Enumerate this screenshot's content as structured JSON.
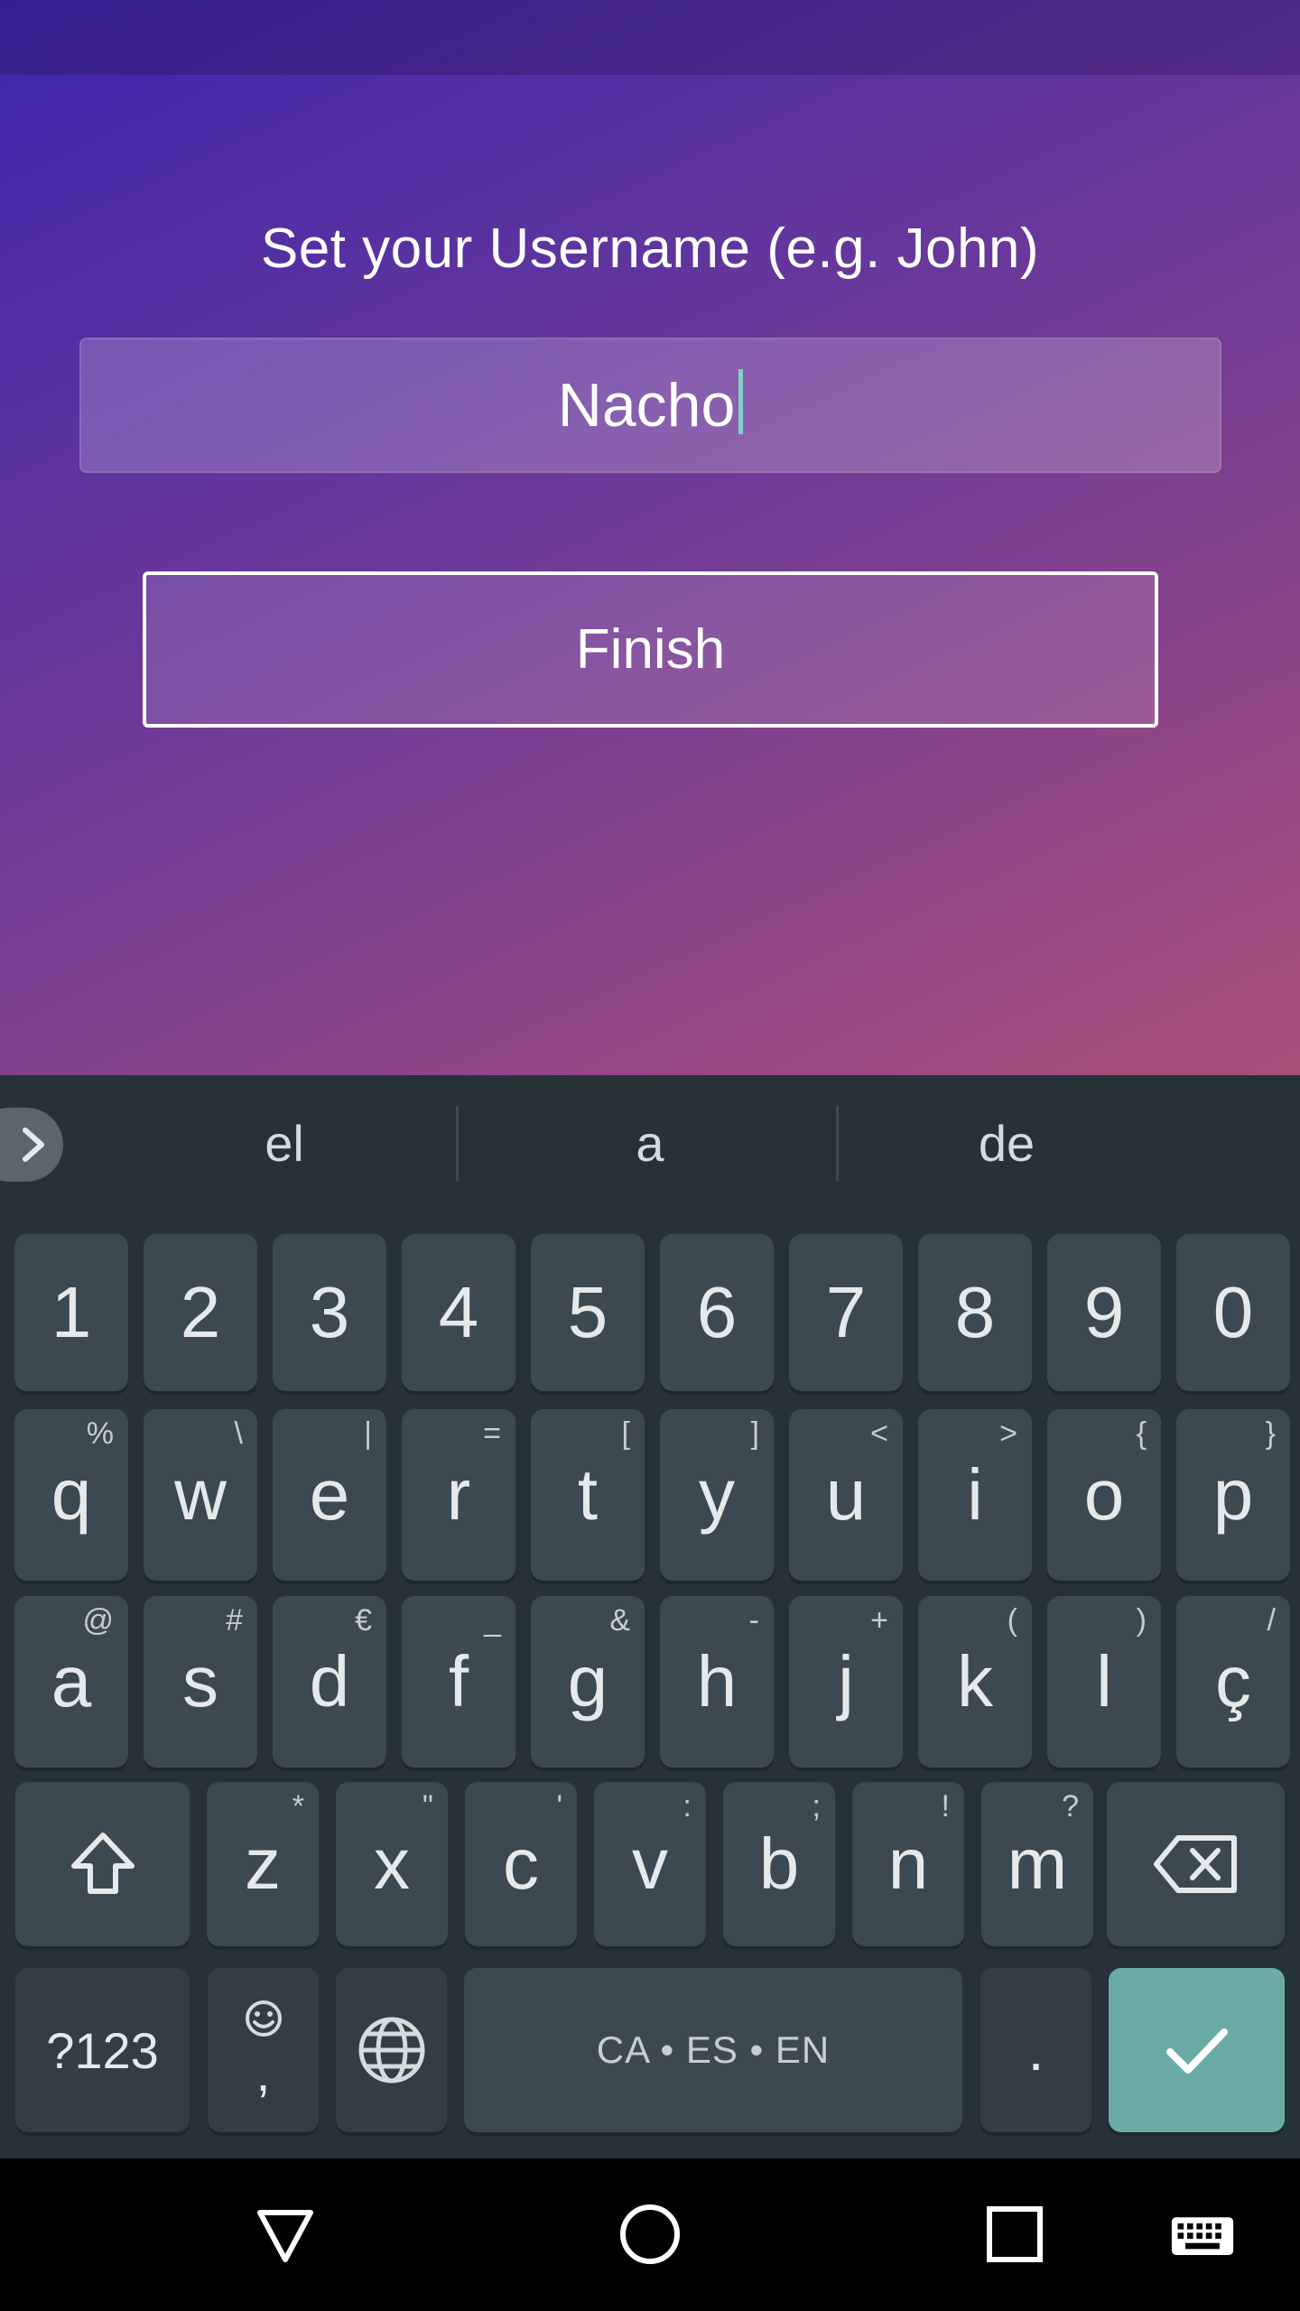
{
  "app": {
    "title": "Set your Username (e.g. John)",
    "username_value": "Nacho",
    "finish_label": "Finish"
  },
  "keyboard": {
    "suggestions": [
      "el",
      "a",
      "de"
    ],
    "number_row": [
      "1",
      "2",
      "3",
      "4",
      "5",
      "6",
      "7",
      "8",
      "9",
      "0"
    ],
    "row1": [
      {
        "key": "q",
        "hint": "%"
      },
      {
        "key": "w",
        "hint": "\\"
      },
      {
        "key": "e",
        "hint": "|"
      },
      {
        "key": "r",
        "hint": "="
      },
      {
        "key": "t",
        "hint": "["
      },
      {
        "key": "y",
        "hint": "]"
      },
      {
        "key": "u",
        "hint": "<"
      },
      {
        "key": "i",
        "hint": ">"
      },
      {
        "key": "o",
        "hint": "{"
      },
      {
        "key": "p",
        "hint": "}"
      }
    ],
    "row2": [
      {
        "key": "a",
        "hint": "@"
      },
      {
        "key": "s",
        "hint": "#"
      },
      {
        "key": "d",
        "hint": "€"
      },
      {
        "key": "f",
        "hint": "_"
      },
      {
        "key": "g",
        "hint": "&"
      },
      {
        "key": "h",
        "hint": "-"
      },
      {
        "key": "j",
        "hint": "+"
      },
      {
        "key": "k",
        "hint": "("
      },
      {
        "key": "l",
        "hint": ")"
      },
      {
        "key": "ç",
        "hint": "/"
      }
    ],
    "row3": [
      {
        "key": "z",
        "hint": "*"
      },
      {
        "key": "x",
        "hint": "\""
      },
      {
        "key": "c",
        "hint": "'"
      },
      {
        "key": "v",
        "hint": ":"
      },
      {
        "key": "b",
        "hint": ";"
      },
      {
        "key": "n",
        "hint": "!"
      },
      {
        "key": "m",
        "hint": "?"
      }
    ],
    "symbols_label": "?123",
    "comma_label": ",",
    "space_label": "CA • ES • EN",
    "period_label": ".",
    "icons": {
      "shift": "shift-icon",
      "backspace": "backspace-icon",
      "emoji": "emoji-icon",
      "globe": "globe-icon",
      "enter": "checkmark-icon",
      "suggest_toggle": "chevron-right-icon"
    },
    "colors": {
      "enter_key": "#6aaca5",
      "caret": "#7fd3c8",
      "keyboard_bg": "#263238"
    }
  },
  "navbar": {
    "icons": [
      "back-triangle-icon",
      "home-circle-icon",
      "recents-square-icon",
      "keyboard-icon"
    ]
  }
}
